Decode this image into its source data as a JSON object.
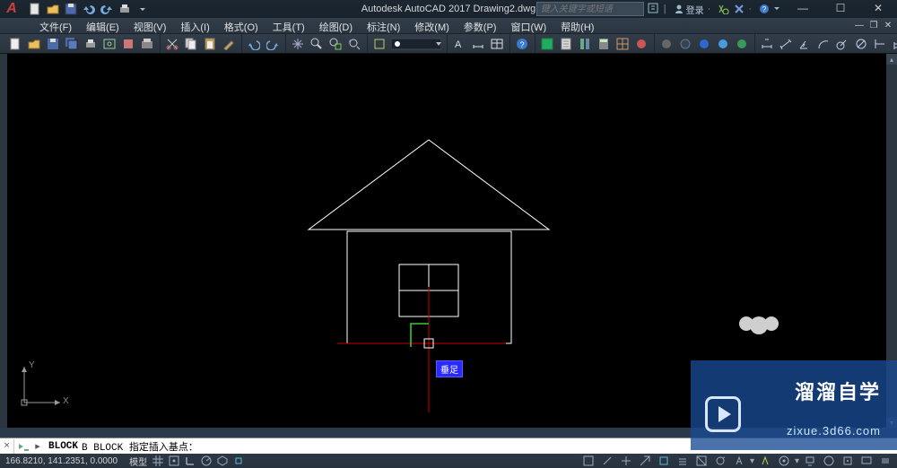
{
  "app": {
    "logo_letter": "A",
    "title": "Autodesk AutoCAD 2017    Drawing2.dwg",
    "search_placeholder": "键入关键字或短语",
    "login_label": "登录"
  },
  "menus": [
    "文件(F)",
    "编辑(E)",
    "视图(V)",
    "插入(I)",
    "格式(O)",
    "工具(T)",
    "绘图(D)",
    "标注(N)",
    "修改(M)",
    "参数(P)",
    "窗口(W)",
    "帮助(H)"
  ],
  "qat_icons": [
    "new",
    "open",
    "save",
    "saveas",
    "undo",
    "redo",
    "plot"
  ],
  "toolbar_groups": [
    [
      "new-doc",
      "open-doc",
      "save",
      "save-all",
      "plot",
      "plot-preview",
      "publish",
      "print"
    ],
    [
      "cut",
      "copy",
      "paste",
      "match-prop"
    ],
    [
      "undo",
      "redo"
    ],
    [
      "pan",
      "zoom-realtime",
      "zoom-window",
      "zoom-previous"
    ],
    [
      "layer-props",
      "layer-dropdown"
    ],
    [
      "line-color",
      "line-weight"
    ],
    [
      "help"
    ],
    [
      "properties",
      "design-center",
      "tool-palette",
      "sheet-set",
      "markup",
      "quickcalc"
    ],
    [
      "globe-1",
      "globe-2",
      "globe-3",
      "globe-4",
      "globe-5"
    ],
    [
      "dim-linear",
      "dim-aligned",
      "dim-angular",
      "dim-arc",
      "dim-radius",
      "dim-diameter",
      "dim-ordinate",
      "dim-baseline",
      "dim-continue"
    ]
  ],
  "snap_tooltip": "垂足",
  "ucs": {
    "y": "Y",
    "x": "X"
  },
  "command_line": {
    "close": "×",
    "caret": "▸",
    "bold_part": "BLOCK",
    "rest_part": "B  BLOCK 指定插入基点："
  },
  "status": {
    "coords": "166.8210, 141.2351, 0.0000",
    "space": "模型",
    "icons": [
      "grid",
      "snap",
      "ortho",
      "polar",
      "osnap",
      "3dosnap",
      "otrack",
      "dyn",
      "lwt",
      "transparency",
      "cycle",
      "ann-scale",
      "ann-vis",
      "ws",
      "hw-accel",
      "isolate",
      "clean",
      "custom"
    ]
  },
  "watermark": {
    "title": "溜溜自学",
    "url": "zixue.3d66.com"
  }
}
